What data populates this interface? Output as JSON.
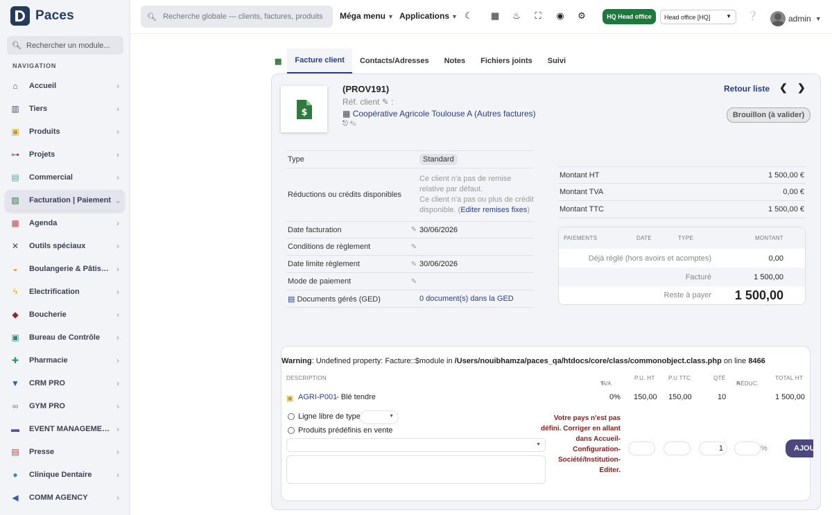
{
  "app": {
    "name": "Paces"
  },
  "sidebar": {
    "search_placeholder": "Rechercher un module...",
    "nav_title": "NAVIGATION",
    "items": [
      {
        "label": "Accueil",
        "icon": "home-icon",
        "color": "#4a4f6a"
      },
      {
        "label": "Tiers",
        "icon": "building-icon",
        "color": "#4a4f6a"
      },
      {
        "label": "Produits",
        "icon": "box-icon",
        "color": "#c8a028"
      },
      {
        "label": "Projets",
        "icon": "sitemap-icon",
        "color": "#8a4a6a"
      },
      {
        "label": "Commercial",
        "icon": "briefcase-icon",
        "color": "#5aa0a0"
      },
      {
        "label": "Facturation | Paiement",
        "icon": "invoice-icon",
        "color": "#2f7a3c"
      },
      {
        "label": "Agenda",
        "icon": "calendar-icon",
        "color": "#c0474d"
      },
      {
        "label": "Outils spéciaux",
        "icon": "tools-icon",
        "color": "#444444"
      },
      {
        "label": "Boulangerie & Pâtisserie",
        "icon": "bread-icon",
        "color": "#d4a020"
      },
      {
        "label": "Electrification",
        "icon": "bolt-icon",
        "color": "#e0b020"
      },
      {
        "label": "Boucherie",
        "icon": "meat-icon",
        "color": "#a02020"
      },
      {
        "label": "Bureau de Contrôle",
        "icon": "control-icon",
        "color": "#2a8a7a"
      },
      {
        "label": "Pharmacie",
        "icon": "plus-icon",
        "color": "#2a9a6a"
      },
      {
        "label": "CRM PRO",
        "icon": "funnel-icon",
        "color": "#3a5ab0"
      },
      {
        "label": "GYM PRO",
        "icon": "dumbbell-icon",
        "color": "#777777"
      },
      {
        "label": "EVENT MANAGEMENT",
        "icon": "event-icon",
        "color": "#5a4aa0"
      },
      {
        "label": "Presse",
        "icon": "newspaper-icon",
        "color": "#a04a4a"
      },
      {
        "label": "Clinique Dentaire",
        "icon": "tooth-icon",
        "color": "#3a8ab0"
      },
      {
        "label": "COMM AGENCY",
        "icon": "megaphone-icon",
        "color": "#3a5ab0"
      }
    ],
    "active_index": 5
  },
  "topbar": {
    "search_placeholder": "Recherche globale — clients, factures, produits...",
    "menu1": "Méga menu",
    "menu2": "Applications",
    "hq_badge": "HQ Head office",
    "hq_select": "Head office [HQ]",
    "user": "admin"
  },
  "tabs": [
    "Facture client",
    "Contacts/Adresses",
    "Notes",
    "Fichiers joints",
    "Suivi"
  ],
  "invoice": {
    "ref": "(PROV191)",
    "ref_client_label": "Réf. client",
    "thirdparty": "Coopérative Agricole Toulouse A",
    "thirdparty_extra": "(Autres factures)",
    "back_link": "Retour liste",
    "status": "Brouillon (à valider)"
  },
  "fields": {
    "type_label": "Type",
    "type_value": "Standard",
    "remise_label": "Réductions ou crédits disponibles",
    "remise_line1": "Ce client n'a pas de remise relative par défaut.",
    "remise_line2": "Ce client n'a pas ou plus de crédit disponible.",
    "remise_link": "Editer remises fixes",
    "date_label": "Date facturation",
    "date_value": "30/06/2026",
    "cond_label": "Conditions de règlement",
    "limit_label": "Date limite règlement",
    "limit_value": "30/06/2026",
    "mode_label": "Mode de paiement",
    "ged_label": "Documents gérés (GED)",
    "ged_value": "0 document(s) dans la GED"
  },
  "amounts": {
    "ht_label": "Montant HT",
    "ht_value": "1 500,00 €",
    "tva_label": "Montant TVA",
    "tva_value": "0,00 €",
    "ttc_label": "Montant TTC",
    "ttc_value": "1 500,00 €"
  },
  "payments": {
    "col_payments": "PAIEMENTS",
    "col_date": "DATE",
    "col_type": "TYPE",
    "col_amount": "MONTANT",
    "paid_label": "Déjà réglé (hors avoirs et acomptes)",
    "paid_value": "0,00",
    "billed_label": "Facturé",
    "billed_value": "1 500,00",
    "due_label": "Reste à payer",
    "due_value": "1 500,00"
  },
  "lines": {
    "warn_prefix": "Warning",
    "warn_text": ": Undefined property: Facture::$module in ",
    "warn_path": "/Users/nouibhamza/paces_qa/htdocs/core/class/commonobject.class.php",
    "warn_mid": " on line ",
    "warn_line": "8466",
    "headers": {
      "desc": "DESCRIPTION",
      "tva": "TVA",
      "pu_ht": "P.U. HT",
      "pu_ttc": "P.U TTC",
      "qty": "QTÉ",
      "reduc": "RÉDUC.",
      "total": "TOTAL HT"
    },
    "row": {
      "ref": "AGRI-P001",
      "label": " - Blé tendre",
      "tva": "0%",
      "pu_ht": "150,00",
      "pu_ttc": "150,00",
      "qty": "10",
      "total": "1 500,00"
    },
    "free_line": "Ligne libre de type",
    "predef": "Produits prédéfinis en vente",
    "qty_default": "1",
    "percent": "%",
    "error": "Votre pays n'est pas défini. Corriger en allant dans Accueil-Configuration-Société/Institution-Editer.",
    "add_button": "AJOUTER"
  },
  "colors": {
    "accent": "#263c8c",
    "due": "#a2202a",
    "hq": "#1d7a3d"
  }
}
